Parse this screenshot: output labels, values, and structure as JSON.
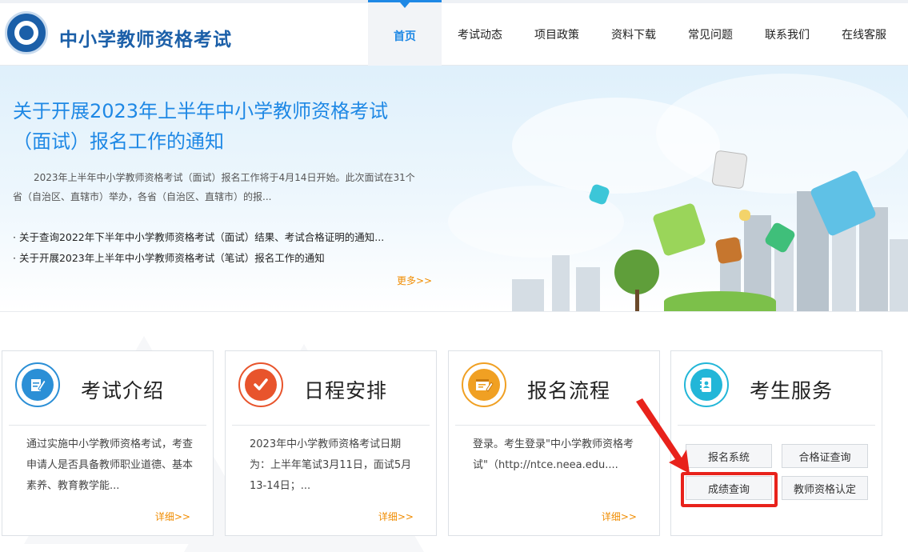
{
  "header": {
    "site_title": "中小学教师资格考试",
    "nav": [
      "首页",
      "考试动态",
      "项目政策",
      "资料下载",
      "常见问题",
      "联系我们",
      "在线客服"
    ],
    "active_nav": "首页"
  },
  "banner": {
    "headline": "关于开展2023年上半年中小学教师资格考试（面试）报名工作的通知",
    "summary": "2023年上半年中小学教师资格考试（面试）报名工作将于4月14日开始。此次面试在31个省（自治区、直辖市）举办，各省（自治区、直辖市）的报...",
    "links": [
      "关于查询2022年下半年中小学教师资格考试（面试）结果、考试合格证明的通知...",
      "关于开展2023年上半年中小学教师资格考试（笔试）报名工作的通知"
    ],
    "more_label": "更多>>"
  },
  "cards": [
    {
      "title": "考试介绍",
      "icon": "pencil-notepad-icon",
      "body": "通过实施中小学教师资格考试，考查申请人是否具备教师职业道德、基本素养、教育教学能...",
      "more_label": "详细>>",
      "accent": "#2b8fd6"
    },
    {
      "title": "日程安排",
      "icon": "checkmark-icon",
      "body": "2023年中小学教师资格考试日期为：上半年笔试3月11日，面试5月13-14日；...",
      "more_label": "详细>>",
      "accent": "#e8542c"
    },
    {
      "title": "报名流程",
      "icon": "form-edit-icon",
      "body": "登录。考生登录\"中小学教师资格考试\"（http://ntce.neea.edu....",
      "more_label": "详细>>",
      "accent": "#f0a023"
    },
    {
      "title": "考生服务",
      "icon": "contact-book-icon",
      "accent": "#22b6d8",
      "buttons": [
        "报名系统",
        "合格证查询",
        "成绩查询",
        "教师资格认定"
      ]
    }
  ],
  "colors": {
    "brand_blue": "#1b5fa8",
    "link_blue": "#1e88e5",
    "more_orange": "#f08c00",
    "highlight_red": "#e8221b"
  }
}
